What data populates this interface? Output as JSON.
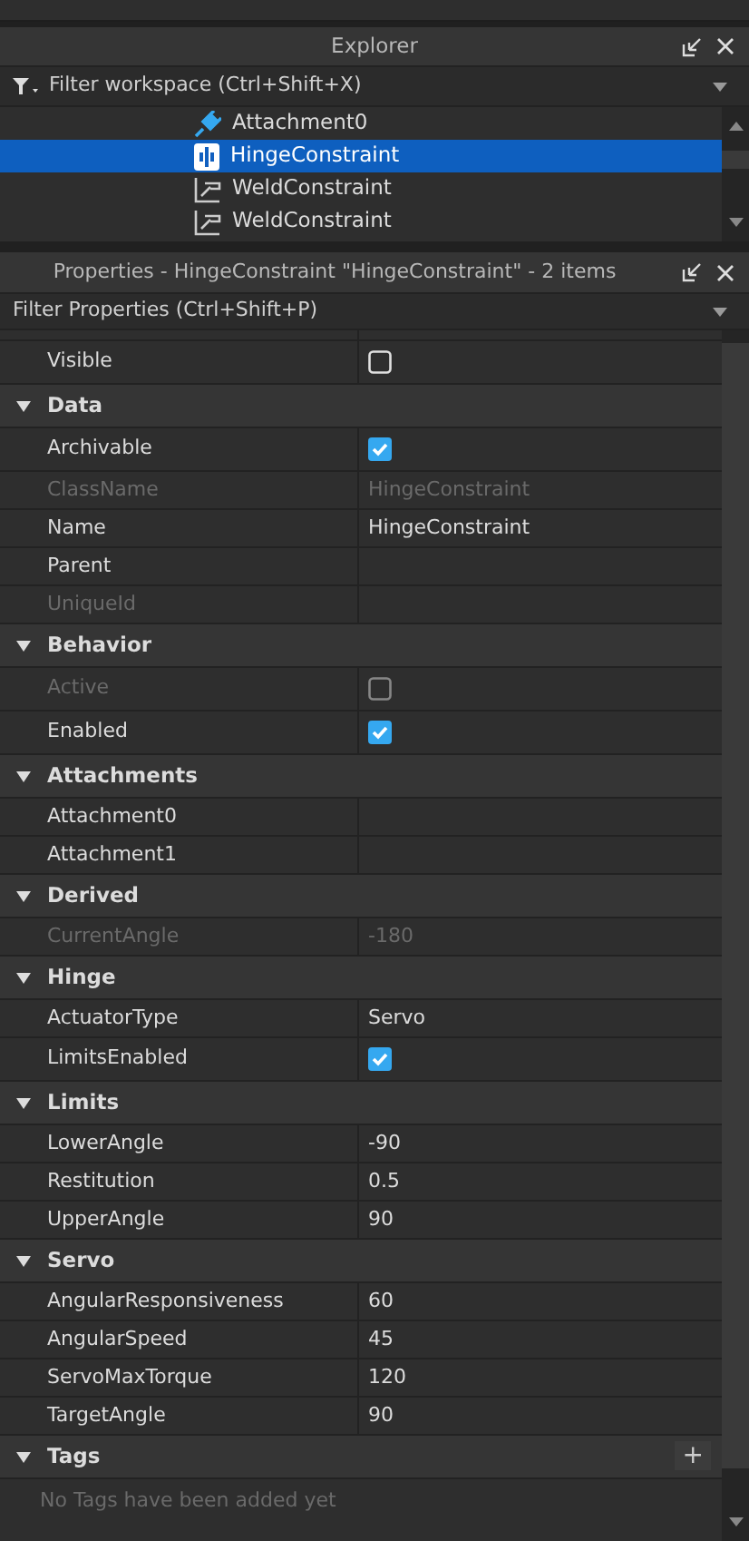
{
  "explorer": {
    "title": "Explorer",
    "filter": {
      "placeholder": "Filter workspace (Ctrl+Shift+X)"
    },
    "items": [
      {
        "label": "Attachment0",
        "kind": "attachment",
        "selected": false
      },
      {
        "label": "HingeConstraint",
        "kind": "hinge",
        "selected": true
      },
      {
        "label": "WeldConstraint",
        "kind": "weld",
        "selected": false
      },
      {
        "label": "WeldConstraint",
        "kind": "weld",
        "selected": false
      }
    ]
  },
  "properties": {
    "title": "Properties - HingeConstraint \"HingeConstraint\" - 2 items",
    "filter": {
      "placeholder": "Filter Properties (Ctrl+Shift+P)"
    },
    "rows": [
      {
        "kind": "check",
        "name": "Visible",
        "checked": false,
        "disabled": false
      },
      {
        "kind": "header",
        "name": "Data",
        "expanded": true
      },
      {
        "kind": "check",
        "name": "Archivable",
        "checked": true,
        "disabled": false
      },
      {
        "kind": "text",
        "name": "ClassName",
        "value": "HingeConstraint",
        "disabled": true
      },
      {
        "kind": "text",
        "name": "Name",
        "value": "HingeConstraint",
        "disabled": false
      },
      {
        "kind": "text",
        "name": "Parent",
        "disabled": false
      },
      {
        "kind": "text",
        "name": "UniqueId",
        "disabled": true
      },
      {
        "kind": "header",
        "name": "Behavior",
        "expanded": true
      },
      {
        "kind": "check",
        "name": "Active",
        "checked": false,
        "disabled": true
      },
      {
        "kind": "check",
        "name": "Enabled",
        "checked": true,
        "disabled": false
      },
      {
        "kind": "header",
        "name": "Attachments",
        "expanded": true
      },
      {
        "kind": "text",
        "name": "Attachment0",
        "disabled": false
      },
      {
        "kind": "text",
        "name": "Attachment1",
        "disabled": false
      },
      {
        "kind": "header",
        "name": "Derived",
        "expanded": true
      },
      {
        "kind": "text",
        "name": "CurrentAngle",
        "value": "-180",
        "disabled": true
      },
      {
        "kind": "header",
        "name": "Hinge",
        "expanded": true
      },
      {
        "kind": "text",
        "name": "ActuatorType",
        "value": "Servo",
        "disabled": false
      },
      {
        "kind": "check",
        "name": "LimitsEnabled",
        "checked": true,
        "disabled": false
      },
      {
        "kind": "header",
        "name": "Limits",
        "expanded": true
      },
      {
        "kind": "text",
        "name": "LowerAngle",
        "value": "-90",
        "disabled": false
      },
      {
        "kind": "text",
        "name": "Restitution",
        "value": "0.5",
        "disabled": false
      },
      {
        "kind": "text",
        "name": "UpperAngle",
        "value": "90",
        "disabled": false
      },
      {
        "kind": "header",
        "name": "Servo",
        "expanded": true
      },
      {
        "kind": "text",
        "name": "AngularResponsiveness",
        "value": "60",
        "disabled": false
      },
      {
        "kind": "text",
        "name": "AngularSpeed",
        "value": "45",
        "disabled": false
      },
      {
        "kind": "text",
        "name": "ServoMaxTorque",
        "value": "120",
        "disabled": false
      },
      {
        "kind": "text",
        "name": "TargetAngle",
        "value": "90",
        "disabled": false
      },
      {
        "kind": "header",
        "name": "Tags",
        "expanded": true,
        "add": "+"
      }
    ],
    "empty_note": "No Tags have been added yet"
  }
}
